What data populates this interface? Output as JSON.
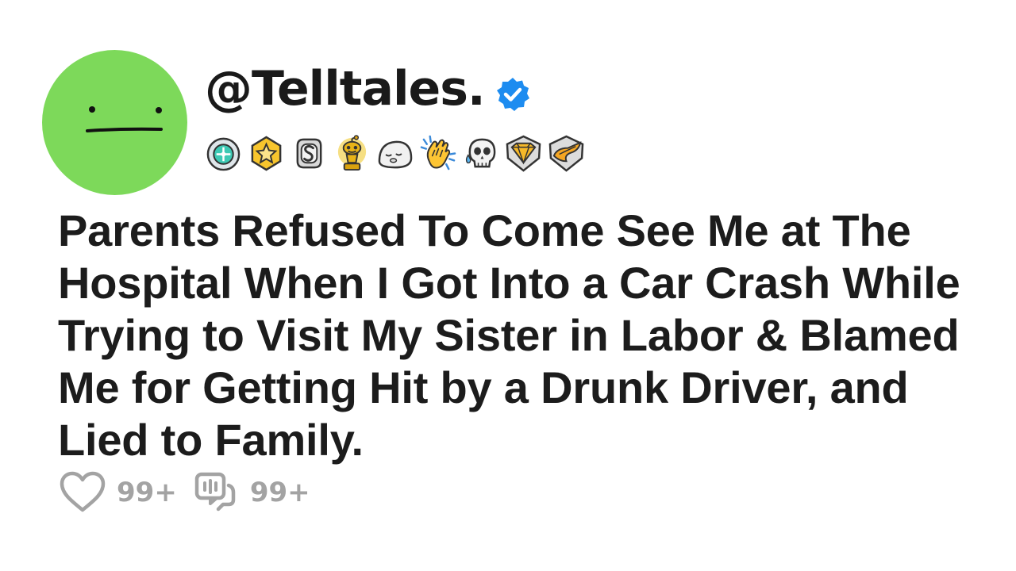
{
  "theme": {
    "avatar_bg": "#7dd95a",
    "verified_color": "#1d8cf0",
    "muted_gray": "#a3a3a3",
    "text_color": "#1c1c1c"
  },
  "author": {
    "username": "@Telltales.",
    "avatar": "neutral-face-icon",
    "verified": true
  },
  "badges": [
    {
      "name": "teal-medal-badge-icon"
    },
    {
      "name": "gold-star-badge-icon"
    },
    {
      "name": "silver-s-badge-icon"
    },
    {
      "name": "gold-robot-trophy-icon"
    },
    {
      "name": "sleepy-blob-icon"
    },
    {
      "name": "clapping-hands-icon"
    },
    {
      "name": "crying-skull-icon"
    },
    {
      "name": "gold-diamond-badge-icon"
    },
    {
      "name": "gold-wing-badge-icon"
    }
  ],
  "post": {
    "title": "Parents Refused To Come See Me at The Hospital When I Got Into a Car Crash While Trying to Visit My Sister in Labor & Blamed Me for Getting Hit by a Drunk Driver, and Lied to Family."
  },
  "stats": {
    "likes": "99+",
    "comments": "99+"
  }
}
